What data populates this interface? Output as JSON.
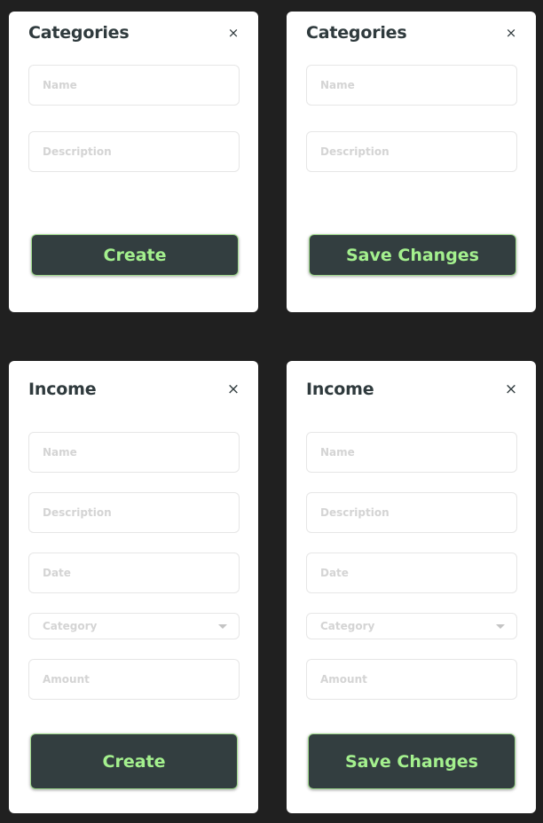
{
  "categories_create": {
    "title": "Categories",
    "close_icon": "×",
    "name_placeholder": "Name",
    "description_placeholder": "Description",
    "button_label": "Create"
  },
  "categories_edit": {
    "title": "Categories",
    "close_icon": "×",
    "name_placeholder": "Name",
    "description_placeholder": "Description",
    "button_label": "Save Changes"
  },
  "income_create": {
    "title": "Income",
    "close_icon": "×",
    "name_placeholder": "Name",
    "description_placeholder": "Description",
    "date_placeholder": "Date",
    "category_placeholder": "Category",
    "amount_placeholder": "Amount",
    "button_label": "Create"
  },
  "income_edit": {
    "title": "Income",
    "close_icon": "×",
    "name_placeholder": "Name",
    "description_placeholder": "Description",
    "date_placeholder": "Date",
    "category_placeholder": "Category",
    "amount_placeholder": "Amount",
    "button_label": "Save Changes"
  },
  "colors": {
    "background": "#202020",
    "panel": "#ffffff",
    "title_text": "#2f3a3d",
    "button_bg": "#333e40",
    "button_text": "#a4f08e",
    "placeholder": "#d4d4d4"
  }
}
